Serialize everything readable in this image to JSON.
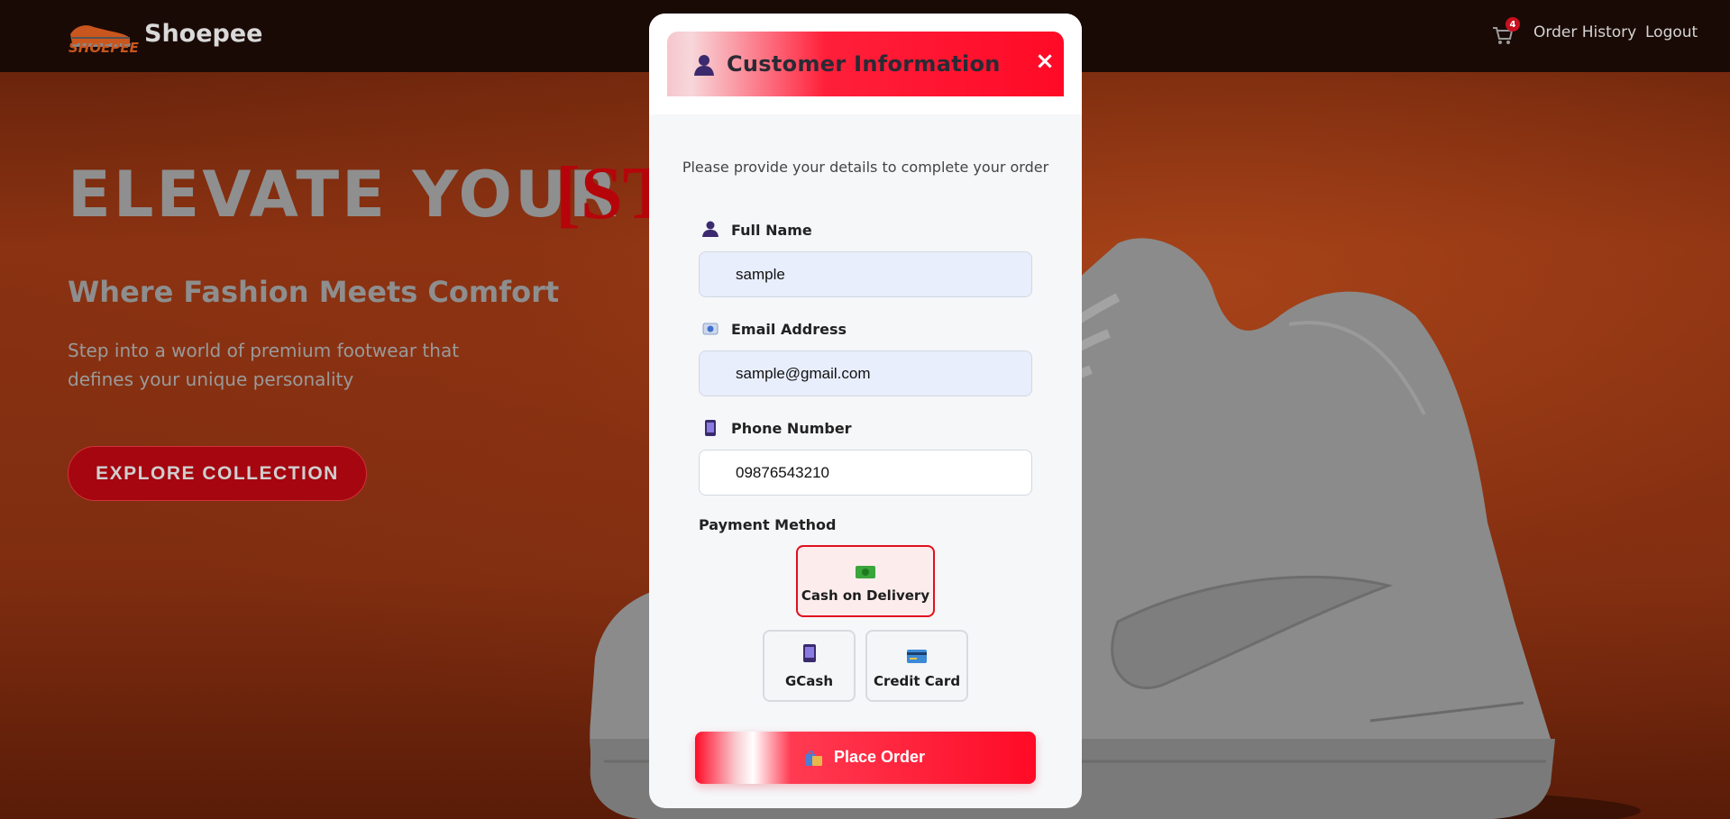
{
  "navbar": {
    "logo_text": "SHOEPEE",
    "brand": "Shoepee",
    "cart_count": "4",
    "order_history": "Order History",
    "logout": "Logout"
  },
  "hero": {
    "title": "ELEVATE YOUR",
    "title_accent": "[ST",
    "subtitle": "Where Fashion Meets Comfort",
    "description": "Step into a world of premium footwear that defines your unique personality",
    "cta": "EXPLORE COLLECTION"
  },
  "modal": {
    "title": "Customer Information",
    "close_symbol": "×",
    "description": "Please provide your details to complete your order",
    "fields": {
      "full_name": {
        "label": "Full Name",
        "value": "sample"
      },
      "email": {
        "label": "Email Address",
        "value": "sample@gmail.com"
      },
      "phone": {
        "label": "Phone Number",
        "value": "09876543210"
      }
    },
    "payment": {
      "label": "Payment Method",
      "options": [
        {
          "label": "Cash on Delivery",
          "icon": "cash-icon",
          "selected": true
        },
        {
          "label": "GCash",
          "icon": "mobile-phone-icon",
          "selected": false
        },
        {
          "label": "Credit Card",
          "icon": "credit-card-icon",
          "selected": false
        }
      ]
    },
    "place_order": "Place Order"
  },
  "colors": {
    "accent_red": "#ff0a26",
    "navbar_bg": "#1a0a05",
    "hero_bg": "#7f2d10"
  }
}
